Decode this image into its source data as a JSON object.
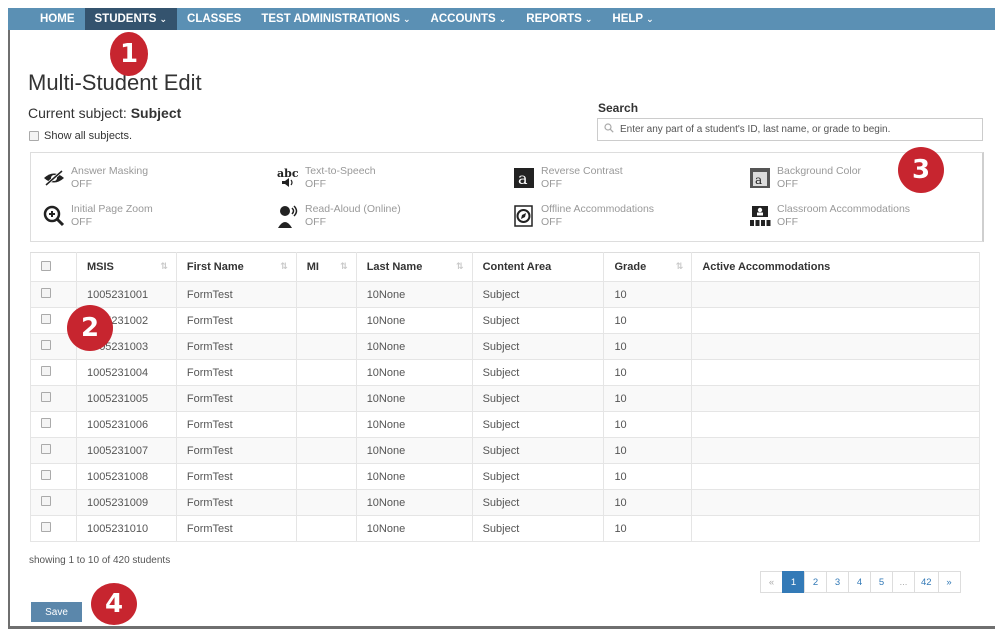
{
  "nav": {
    "items": [
      {
        "label": "HOME",
        "has_menu": false,
        "active": false
      },
      {
        "label": "STUDENTS",
        "has_menu": true,
        "active": true
      },
      {
        "label": "CLASSES",
        "has_menu": false,
        "active": false
      },
      {
        "label": "TEST ADMINISTRATIONS",
        "has_menu": true,
        "active": false
      },
      {
        "label": "ACCOUNTS",
        "has_menu": true,
        "active": false
      },
      {
        "label": "REPORTS",
        "has_menu": true,
        "active": false
      },
      {
        "label": "HELP",
        "has_menu": true,
        "active": false
      }
    ],
    "chevron": "⌄",
    "bg_color": "#5b90b4",
    "active_color": "#34536e"
  },
  "markers": [
    "1",
    "2",
    "3",
    "4"
  ],
  "marker_color": "#c7252f",
  "page": {
    "title": "Multi-Student Edit",
    "subject_prefix": "Current subject: ",
    "subject_value": "Subject",
    "show_all_label": "Show all subjects."
  },
  "search": {
    "label": "Search",
    "placeholder": "Enter any part of a student's ID, last name, or grade to begin."
  },
  "accommodations": [
    {
      "name": "Answer Masking",
      "status": "OFF",
      "icon": "eye-slash-icon"
    },
    {
      "name": "Text-to-Speech",
      "status": "OFF",
      "icon": "abc-speaker-icon"
    },
    {
      "name": "Reverse Contrast",
      "status": "OFF",
      "icon": "letter-a-icon"
    },
    {
      "name": "Background Color",
      "status": "OFF",
      "icon": "background-color-icon"
    },
    {
      "name": "Initial Page Zoom",
      "status": "OFF",
      "icon": "zoom-in-icon"
    },
    {
      "name": "Read-Aloud (Online)",
      "status": "OFF",
      "icon": "read-aloud-icon"
    },
    {
      "name": "Offline Accommodations",
      "status": "OFF",
      "icon": "compass-icon"
    },
    {
      "name": "Classroom Accommodations",
      "status": "OFF",
      "icon": "classroom-icon"
    }
  ],
  "table": {
    "columns": [
      {
        "label": "",
        "sortable": false
      },
      {
        "label": "MSIS",
        "sortable": true
      },
      {
        "label": "First Name",
        "sortable": true
      },
      {
        "label": "MI",
        "sortable": true
      },
      {
        "label": "Last Name",
        "sortable": true
      },
      {
        "label": "Content Area",
        "sortable": false
      },
      {
        "label": "Grade",
        "sortable": true
      },
      {
        "label": "Active Accommodations",
        "sortable": false
      }
    ],
    "sort_icon": "⇅",
    "rows": [
      {
        "msis": "1005231001",
        "first": "FormTest",
        "mi": "",
        "last": "10None",
        "area": "Subject",
        "grade": "10",
        "active": ""
      },
      {
        "msis": "1005231002",
        "first": "FormTest",
        "mi": "",
        "last": "10None",
        "area": "Subject",
        "grade": "10",
        "active": ""
      },
      {
        "msis": "1005231003",
        "first": "FormTest",
        "mi": "",
        "last": "10None",
        "area": "Subject",
        "grade": "10",
        "active": ""
      },
      {
        "msis": "1005231004",
        "first": "FormTest",
        "mi": "",
        "last": "10None",
        "area": "Subject",
        "grade": "10",
        "active": ""
      },
      {
        "msis": "1005231005",
        "first": "FormTest",
        "mi": "",
        "last": "10None",
        "area": "Subject",
        "grade": "10",
        "active": ""
      },
      {
        "msis": "1005231006",
        "first": "FormTest",
        "mi": "",
        "last": "10None",
        "area": "Subject",
        "grade": "10",
        "active": ""
      },
      {
        "msis": "1005231007",
        "first": "FormTest",
        "mi": "",
        "last": "10None",
        "area": "Subject",
        "grade": "10",
        "active": ""
      },
      {
        "msis": "1005231008",
        "first": "FormTest",
        "mi": "",
        "last": "10None",
        "area": "Subject",
        "grade": "10",
        "active": ""
      },
      {
        "msis": "1005231009",
        "first": "FormTest",
        "mi": "",
        "last": "10None",
        "area": "Subject",
        "grade": "10",
        "active": ""
      },
      {
        "msis": "1005231010",
        "first": "FormTest",
        "mi": "",
        "last": "10None",
        "area": "Subject",
        "grade": "10",
        "active": ""
      }
    ]
  },
  "footer": {
    "showing": "showing 1 to 10 of 420 students",
    "save_label": "Save"
  },
  "pagination": {
    "prev": "«",
    "next": "»",
    "pages": [
      "1",
      "2",
      "3",
      "4",
      "5",
      "...",
      "42"
    ],
    "active_page": "1",
    "accent": "#337ab7"
  }
}
